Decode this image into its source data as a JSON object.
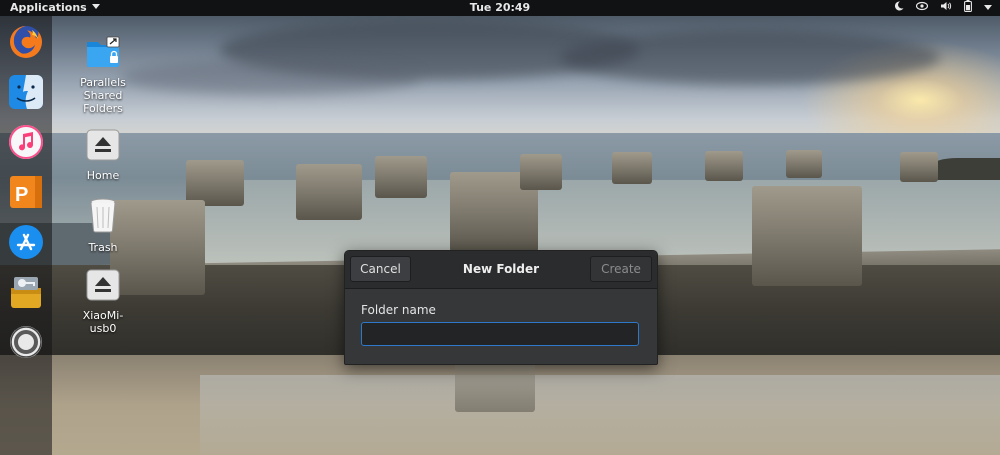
{
  "topbar": {
    "applications_label": "Applications",
    "clock": "Tue 20:49",
    "tray": [
      {
        "icon": "night-light-icon"
      },
      {
        "icon": "privacy-indicator-icon"
      },
      {
        "icon": "volume-icon"
      },
      {
        "icon": "battery-icon"
      },
      {
        "icon": "system-menu-caret-icon"
      }
    ]
  },
  "dock": {
    "items": [
      {
        "name": "firefox",
        "icon": "firefox-icon"
      },
      {
        "name": "finder",
        "icon": "finder-icon"
      },
      {
        "name": "itunes",
        "icon": "itunes-icon"
      },
      {
        "name": "presentation",
        "icon": "presentation-icon"
      },
      {
        "name": "app-store",
        "icon": "app-store-icon"
      },
      {
        "name": "keychain",
        "icon": "keychain-icon"
      },
      {
        "name": "help",
        "icon": "help-icon"
      }
    ]
  },
  "desktop": {
    "icons": [
      {
        "label": "Parallels Shared Folders",
        "icon": "shared-folder-icon"
      },
      {
        "label": "Home",
        "icon": "eject-icon"
      },
      {
        "label": "Trash",
        "icon": "trash-icon"
      },
      {
        "label": "XiaoMi-usb0",
        "icon": "eject-icon"
      }
    ]
  },
  "dialog": {
    "title": "New Folder",
    "cancel_label": "Cancel",
    "create_label": "Create",
    "field_label": "Folder name",
    "field_value": ""
  },
  "colors": {
    "topbar_bg": "#111214",
    "dialog_bg": "#353739",
    "focus_border": "#2e78c9"
  }
}
